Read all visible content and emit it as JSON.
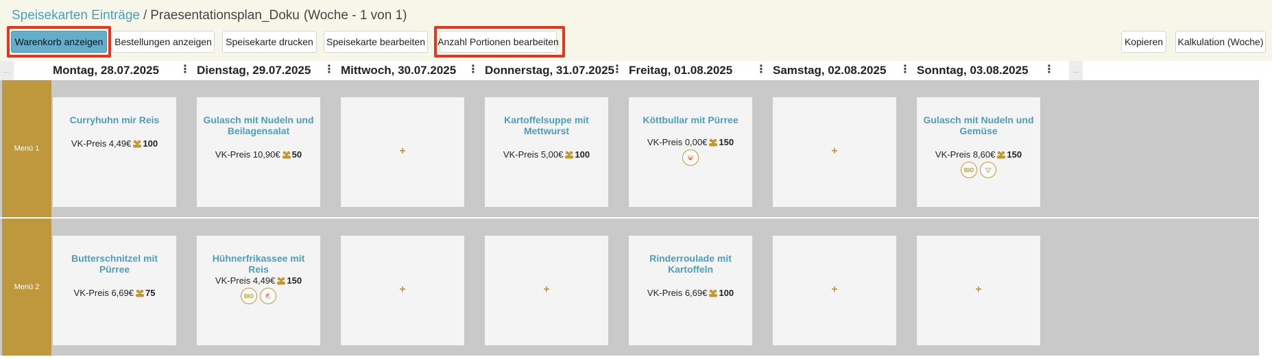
{
  "breadcrumb": {
    "link": "Speisekarten Einträge",
    "separator": "/",
    "plan": "Praesentationsplan_Doku",
    "week": "(Woche - 1 von 1)"
  },
  "toolbar": {
    "cart": "Warenkorb anzeigen",
    "orders": "Bestellungen anzeigen",
    "print": "Speisekarte drucken",
    "edit": "Speisekarte bearbeiten",
    "portions": "Anzahl Portionen bearbeiten",
    "copy": "Kopieren",
    "calc": "Kalkulation (Woche)"
  },
  "icons": {
    "left_arrow": "←",
    "right_arrow": "→",
    "kebab": "⋮",
    "plus": "+"
  },
  "days": [
    "Montag, 28.07.2025",
    "Dienstag, 29.07.2025",
    "Mittwoch, 30.07.2025",
    "Donnerstag, 31.07.2025",
    "Freitag, 01.08.2025",
    "Samstag, 02.08.2025",
    "Sonntag, 03.08.2025"
  ],
  "price_label": "VK-Preis",
  "menus": [
    {
      "label": "Menü 1",
      "cells": [
        {
          "title": "Curryhuhn mir Reis",
          "price": "4,49€",
          "portions": "100"
        },
        {
          "title": "Gulasch mit Nudeln und Beilagensalat",
          "price": "10,90€",
          "portions": "50"
        },
        {
          "empty": true
        },
        {
          "title": "Kartoffelsuppe mit Mettwurst",
          "price": "5,00€",
          "portions": "100"
        },
        {
          "title": "Köttbullar mit Pürree",
          "price": "0,00€",
          "portions": "150",
          "badges": [
            "pig-icon"
          ]
        },
        {
          "empty": true
        },
        {
          "title": "Gulasch mit Nudeln und Gemüse",
          "price": "8,60€",
          "portions": "150",
          "badges": [
            "bio-icon",
            "cow-icon"
          ]
        }
      ]
    },
    {
      "label": "Menü 2",
      "cells": [
        {
          "title": "Butterschnitzel mit Pürree",
          "price": "6,69€",
          "portions": "75"
        },
        {
          "title": "Hühnerfrikassee mit Reis",
          "price": "4,49€",
          "portions": "150",
          "badges": [
            "bio-icon",
            "chicken-icon"
          ]
        },
        {
          "empty": true
        },
        {
          "empty": true
        },
        {
          "title": "Rinderroulade mit Kartoffeln",
          "price": "6,69€",
          "portions": "100"
        },
        {
          "empty": true
        },
        {
          "empty": true
        }
      ]
    }
  ],
  "colors": {
    "accent": "#bf973d",
    "link": "#4a9fc0",
    "highlight": "#e8331d",
    "primary_button": "#64aecb"
  }
}
